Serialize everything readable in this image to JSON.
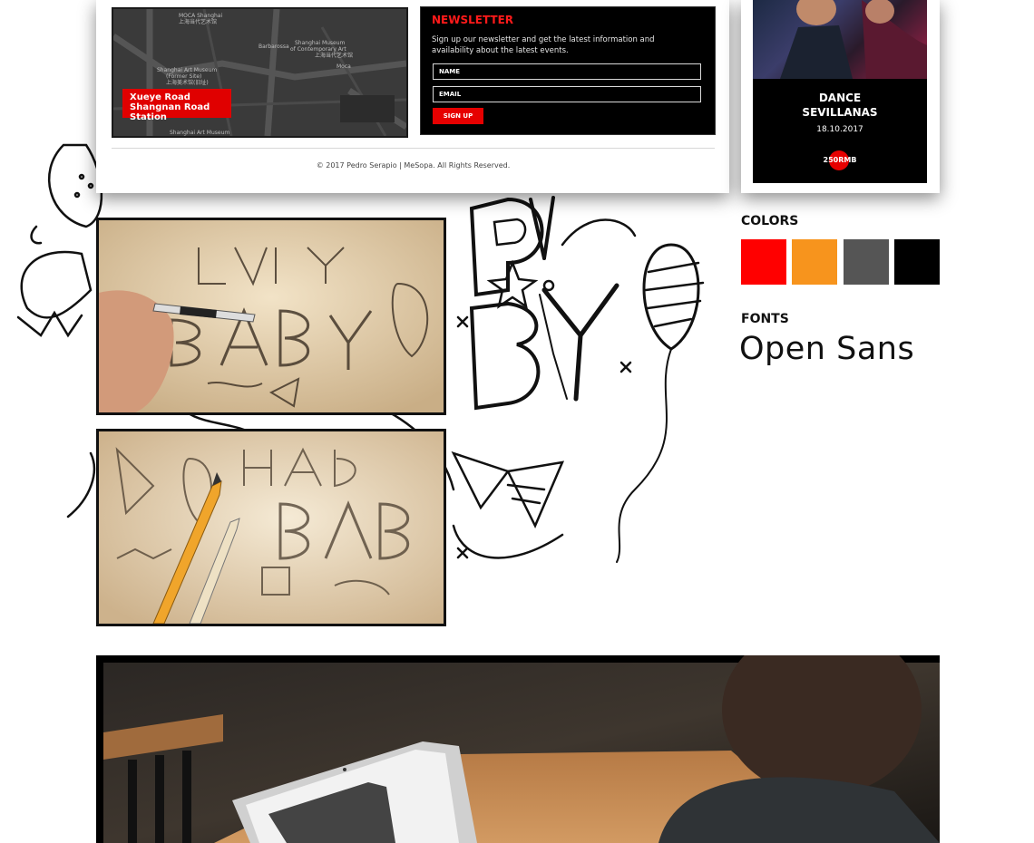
{
  "newsletter": {
    "title": "NEWSLETTER",
    "text": "Sign up our newsletter and get the latest information and availability about the latest events.",
    "name_label": "NAME",
    "email_label": "EMAIL",
    "button_label": "SIGN UP"
  },
  "map": {
    "labels": [
      "MOCA Shanghai",
      "上海当代艺术馆",
      "Barbarossa",
      "Shanghai Museum",
      "of Contemporary Art",
      "上海当代艺术馆",
      "Moca",
      "Shanghai Art Museum",
      "(Former Site)",
      "上海美术馆(旧址)",
      "Shanghai Art Museum"
    ],
    "station": "Xueye Road Shangnan Road Station"
  },
  "footer": "© 2017 Pedro Serapio | MeSopa. All Rights Reserved.",
  "event": {
    "title_line1": "DANCE",
    "title_line2": "SEVILLANAS",
    "date": "18.10.2017",
    "price": "250RMB"
  },
  "style_guide": {
    "colors_label": "COLORS",
    "colors": [
      "#ff0000",
      "#f7941d",
      "#555555",
      "#000000"
    ],
    "fonts_label": "FONTS",
    "font_name": "Open Sans"
  }
}
